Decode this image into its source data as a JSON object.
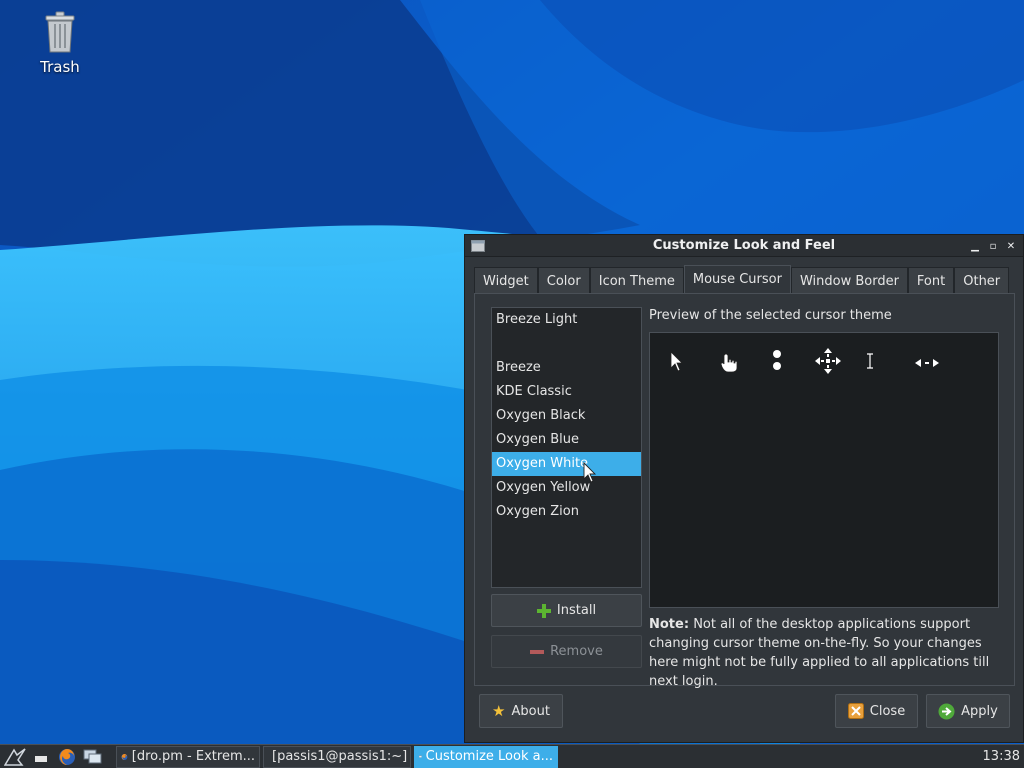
{
  "desktop": {
    "trash_label": "Trash"
  },
  "window": {
    "title": "Customize Look and Feel",
    "tabs": [
      {
        "label": "Widget",
        "active": false
      },
      {
        "label": "Color",
        "active": false
      },
      {
        "label": "Icon Theme",
        "active": false
      },
      {
        "label": "Mouse Cursor",
        "active": true
      },
      {
        "label": "Window Border",
        "active": false
      },
      {
        "label": "Font",
        "active": false
      },
      {
        "label": "Other",
        "active": false
      }
    ],
    "themes": [
      {
        "label": "Breeze Light",
        "selected": false
      },
      {
        "label": "Breeze",
        "selected": false
      },
      {
        "label": "KDE Classic",
        "selected": false
      },
      {
        "label": "Oxygen Black",
        "selected": false
      },
      {
        "label": "Oxygen Blue",
        "selected": false
      },
      {
        "label": "Oxygen White",
        "selected": true
      },
      {
        "label": "Oxygen Yellow",
        "selected": false
      },
      {
        "label": "Oxygen Zion",
        "selected": false
      }
    ],
    "install_label": "Install",
    "remove_label": "Remove",
    "preview_label": "Preview of the selected cursor theme",
    "preview_cursors": [
      "arrow-cursor-icon",
      "hand-cursor-icon",
      "wait-cursor-icon",
      "move-cursor-icon",
      "text-cursor-icon",
      "resize-horizontal-cursor-icon"
    ],
    "note_title": "Note:",
    "note_text": "Not all of the desktop applications support changing cursor theme on-the-fly. So your changes here might not be fully applied to all applications till next login.",
    "about_label": "About",
    "close_label": "Close",
    "apply_label": "Apply"
  },
  "taskbar": {
    "tasks": [
      {
        "label": "[dro.pm - Extrem...",
        "icon": "firefox-icon",
        "active": false
      },
      {
        "label": "[passis1@passis1:~]",
        "icon": "terminal-icon",
        "active": false
      },
      {
        "label": "Customize Look a...",
        "icon": "window-icon",
        "active": true
      }
    ],
    "clock": "13:38"
  },
  "colors": {
    "accent": "#3daee9",
    "window_bg": "#31363b",
    "wallpaper_dark": "#0a3d91",
    "wallpaper_light": "#29b6f6"
  }
}
